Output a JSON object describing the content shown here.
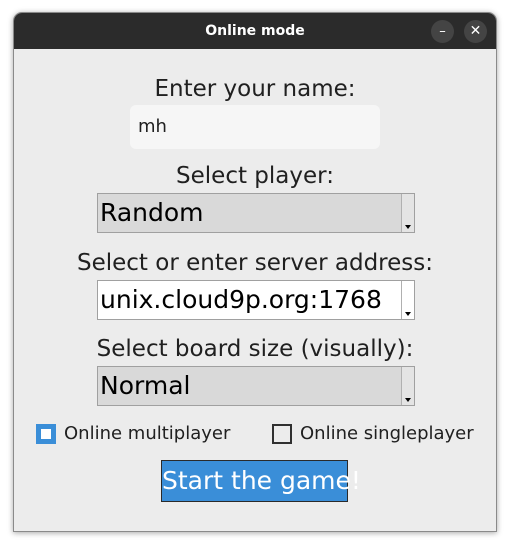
{
  "window": {
    "title": "Online mode",
    "minimize_icon": "minimize-icon",
    "close_icon": "close-icon"
  },
  "name_section": {
    "label": "Enter your name:",
    "value": "mh"
  },
  "player_section": {
    "label": "Select player:",
    "selected": "Random"
  },
  "server_section": {
    "label": "Select or enter server address:",
    "value": "unix.cloud9p.org:1768"
  },
  "board_section": {
    "label": "Select board size (visually):",
    "selected": "Normal"
  },
  "modes": [
    {
      "label": "Online multiplayer",
      "checked": true
    },
    {
      "label": "Online singleplayer",
      "checked": false
    }
  ],
  "start_button": {
    "label": "Start the game!"
  },
  "colors": {
    "accent": "#3a8ed8",
    "titlebar": "#2b2b2b",
    "background": "#ececec"
  }
}
